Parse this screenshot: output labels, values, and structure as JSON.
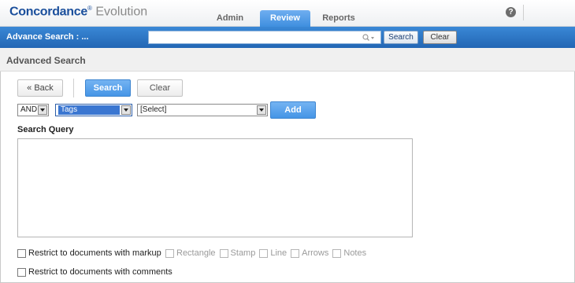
{
  "app": {
    "brand": "Concordance",
    "registered": "®",
    "product": "Evolution"
  },
  "nav": {
    "tabs": [
      {
        "label": "Admin"
      },
      {
        "label": "Review"
      },
      {
        "label": "Reports"
      }
    ],
    "help_symbol": "?"
  },
  "search_bar": {
    "title": "Advance Search : ...",
    "value": "",
    "search_label": "Search",
    "clear_label": "Clear"
  },
  "section": {
    "title": "Advanced Search"
  },
  "actions": {
    "back_label": "« Back",
    "search_label": "Search",
    "clear_label": "Clear"
  },
  "query_builder": {
    "operator": "AND",
    "field": "Tags",
    "value": "[Select]",
    "add_label": "Add"
  },
  "query": {
    "label": "Search Query",
    "value": ""
  },
  "filters": {
    "markup_label": "Restrict to documents with markup",
    "markup_types": [
      "Rectangle",
      "Stamp",
      "Line",
      "Arrows",
      "Notes"
    ],
    "comments_label": "Restrict to documents with comments"
  },
  "colors": {
    "accent": "#3f8fdf",
    "bar": "#2266b4",
    "brand": "#1b4f9c"
  }
}
